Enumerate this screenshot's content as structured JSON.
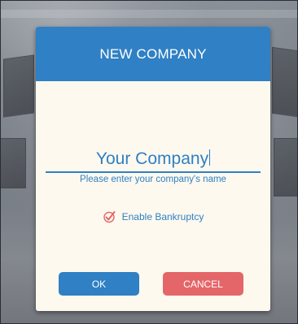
{
  "dialog": {
    "title": "NEW COMPANY",
    "company_name_value": "Your Company",
    "company_name_hint": "Please enter your company's name",
    "bankruptcy": {
      "label": "Enable Bankruptcy",
      "checked": true
    },
    "ok_label": "OK",
    "cancel_label": "CANCEL"
  },
  "colors": {
    "accent_blue": "#2f80c4",
    "cancel_red": "#e46669",
    "dialog_bg": "#fdf9ef"
  },
  "icons": {
    "checkbox": "checkmark-icon"
  }
}
